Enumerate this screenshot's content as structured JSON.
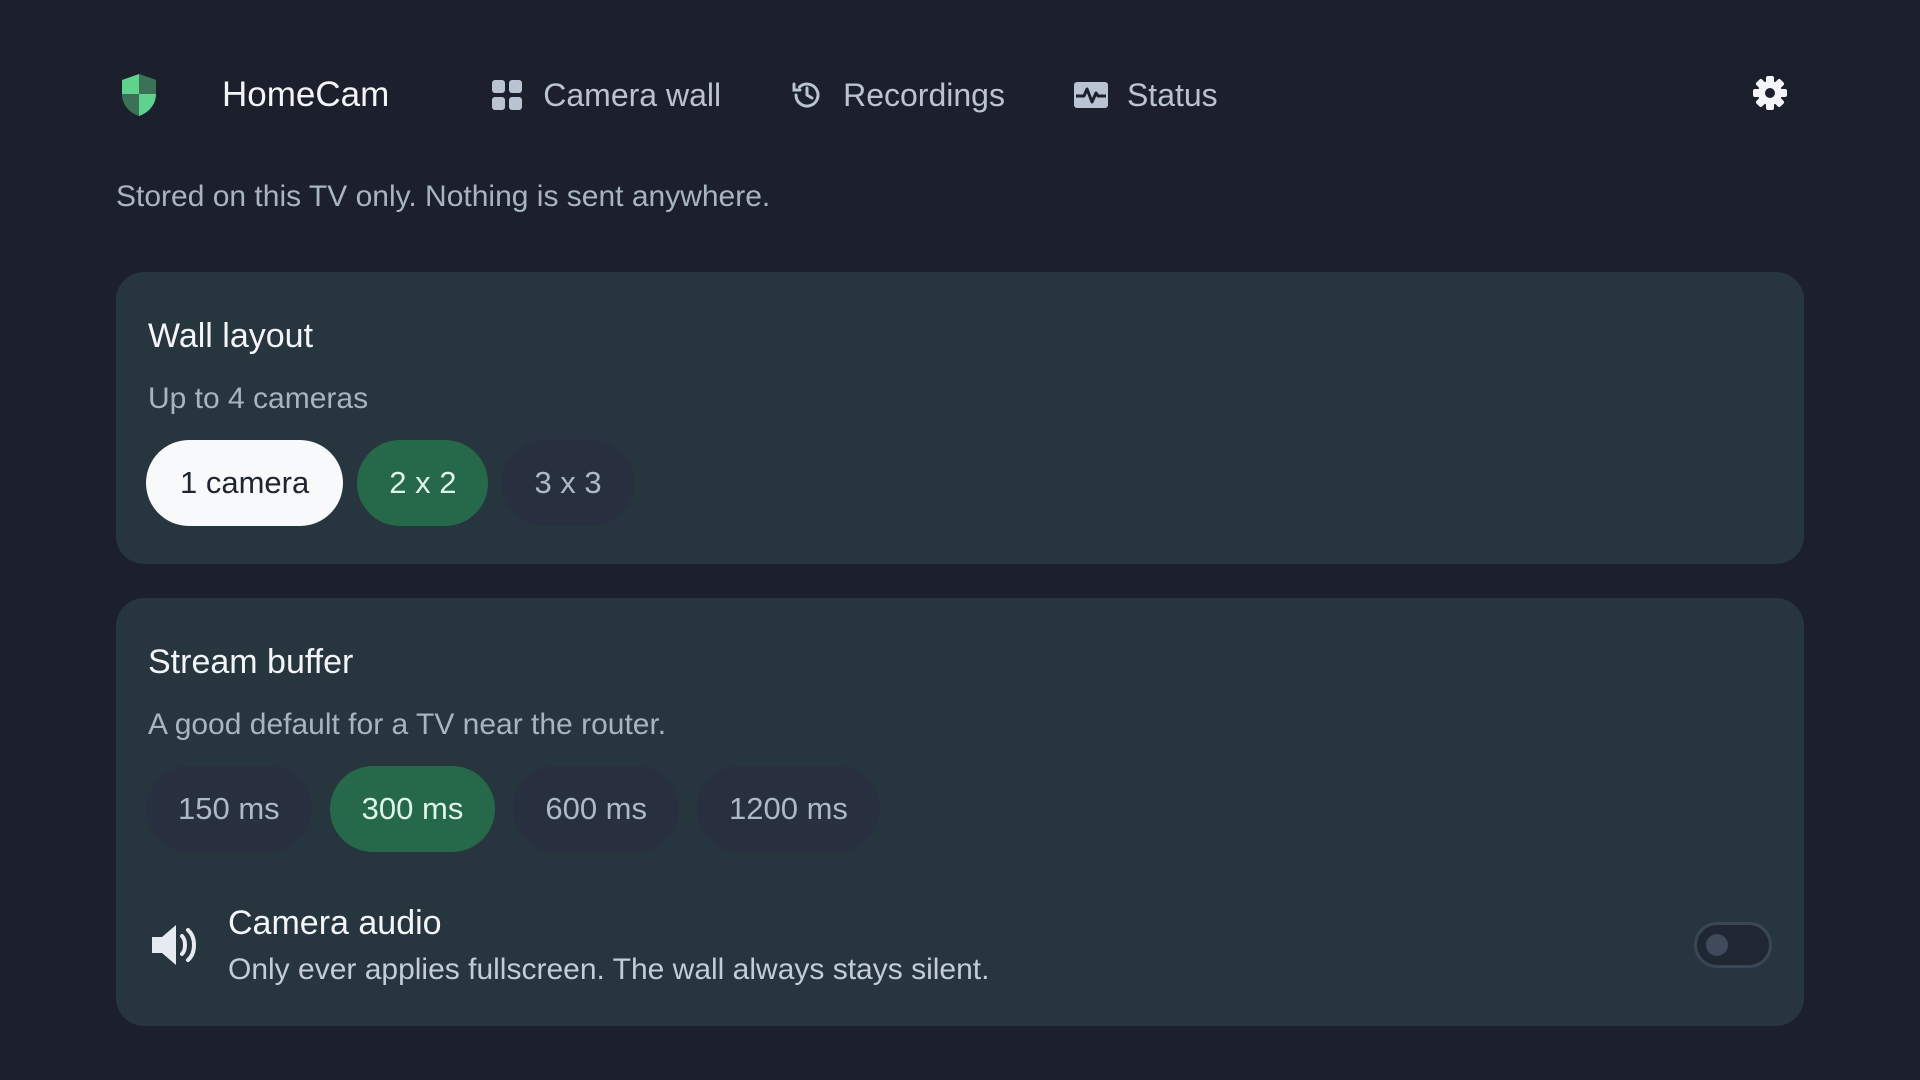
{
  "app": {
    "name": "HomeCam"
  },
  "nav": [
    {
      "label": "Camera wall",
      "icon": "grid-icon"
    },
    {
      "label": "Recordings",
      "icon": "history-icon"
    },
    {
      "label": "Status",
      "icon": "pulse-icon"
    }
  ],
  "notice": "Stored on this TV only. Nothing is sent anywhere.",
  "wall_layout": {
    "title": "Wall layout",
    "subtitle": "Up to 4 cameras",
    "options": [
      {
        "label": "1 camera",
        "state": "focused"
      },
      {
        "label": "2 x 2",
        "state": "selected"
      },
      {
        "label": "3 x 3",
        "state": "normal"
      }
    ]
  },
  "stream_buffer": {
    "title": "Stream buffer",
    "subtitle": "A good default for a TV near the router.",
    "options": [
      {
        "label": "150 ms",
        "state": "normal"
      },
      {
        "label": "300 ms",
        "state": "selected"
      },
      {
        "label": "600 ms",
        "state": "normal"
      },
      {
        "label": "1200 ms",
        "state": "normal"
      }
    ]
  },
  "camera_audio": {
    "title": "Camera audio",
    "description": "Only ever applies fullscreen. The wall always stays silent.",
    "enabled": false
  },
  "colors": {
    "background": "#1b202c",
    "card": "#27353e",
    "accent_green": "#26694a",
    "logo_green": "#5fd38d"
  }
}
